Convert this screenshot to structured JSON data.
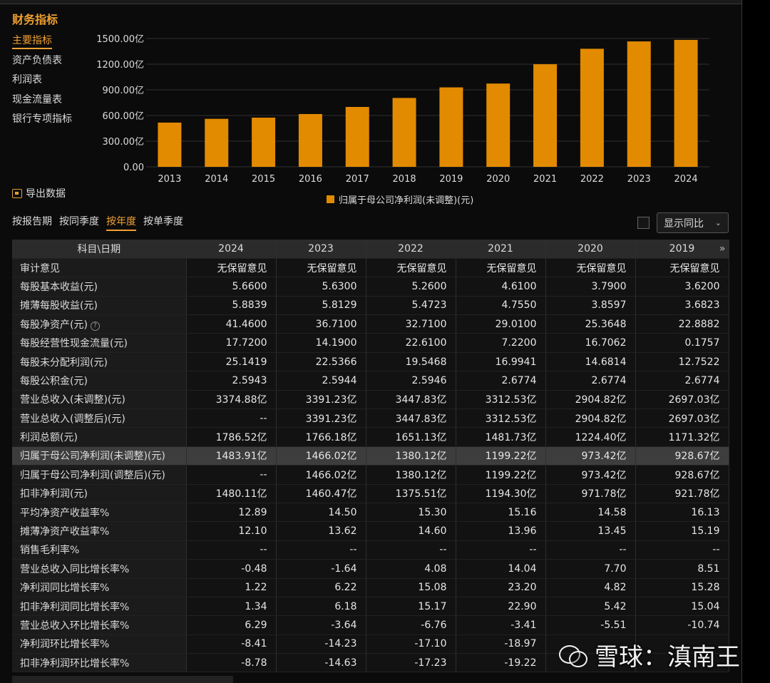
{
  "panel": {
    "title": "财务指标"
  },
  "sidebar": {
    "items": [
      {
        "label": "主要指标",
        "active": true
      },
      {
        "label": "资产负债表",
        "active": false
      },
      {
        "label": "利润表",
        "active": false
      },
      {
        "label": "现金流量表",
        "active": false
      },
      {
        "label": "银行专项指标",
        "active": false
      }
    ]
  },
  "chart_data": {
    "type": "bar",
    "categories": [
      "2013",
      "2014",
      "2015",
      "2016",
      "2017",
      "2018",
      "2019",
      "2020",
      "2021",
      "2022",
      "2023",
      "2024"
    ],
    "series": [
      {
        "name": "归属于母公司净利润(未调整)(元)",
        "values": [
          517,
          561,
          575,
          617,
          700,
          805,
          928.67,
          973.42,
          1199.22,
          1380.12,
          1466.02,
          1483.91
        ]
      }
    ],
    "ylim": [
      0,
      1500
    ],
    "yticks": [
      0,
      300,
      600,
      900,
      1200,
      1500
    ],
    "ytick_labels": [
      "0.00",
      "300.00亿",
      "600.00亿",
      "900.00亿",
      "1200.00亿",
      "1500.00亿"
    ],
    "grid": true,
    "legend": "bottom-center",
    "bar_color": "#e28a00"
  },
  "export_label": "导出数据",
  "legend_label": "归属于母公司净利润(未调整)(元)",
  "period_tabs": [
    {
      "label": "按报告期",
      "active": false
    },
    {
      "label": "按同季度",
      "active": false
    },
    {
      "label": "按年度",
      "active": true
    },
    {
      "label": "按单季度",
      "active": false
    }
  ],
  "yoy_toggle": {
    "label": "显示同比",
    "checked": false
  },
  "table": {
    "header": [
      "科目\\日期",
      "2024",
      "2023",
      "2022",
      "2021",
      "2020",
      "2019"
    ],
    "rows": [
      {
        "label": "审计意见",
        "values": [
          "无保留意见",
          "无保留意见",
          "无保留意见",
          "无保留意见",
          "无保留意见",
          "无保留意见"
        ]
      },
      {
        "label": "每股基本收益(元)",
        "values": [
          "5.6600",
          "5.6300",
          "5.2600",
          "4.6100",
          "3.7900",
          "3.6200"
        ]
      },
      {
        "label": "摊薄每股收益(元)",
        "values": [
          "5.8839",
          "5.8129",
          "5.4723",
          "4.7550",
          "3.8597",
          "3.6823"
        ]
      },
      {
        "label": "每股净资产(元)",
        "help": "?",
        "values": [
          "41.4600",
          "36.7100",
          "32.7100",
          "29.0100",
          "25.3648",
          "22.8882"
        ]
      },
      {
        "label": "每股经营性现金流量(元)",
        "values": [
          "17.7200",
          "14.1900",
          "22.6100",
          "7.2200",
          "16.7062",
          "0.1757"
        ]
      },
      {
        "label": "每股未分配利润(元)",
        "values": [
          "25.1419",
          "22.5366",
          "19.5468",
          "16.9941",
          "14.6814",
          "12.7522"
        ]
      },
      {
        "label": "每股公积金(元)",
        "values": [
          "2.5943",
          "2.5944",
          "2.5946",
          "2.6774",
          "2.6774",
          "2.6774"
        ]
      },
      {
        "label": "营业总收入(未调整)(元)",
        "values": [
          "3374.88亿",
          "3391.23亿",
          "3447.83亿",
          "3312.53亿",
          "2904.82亿",
          "2697.03亿"
        ]
      },
      {
        "label": "营业总收入(调整后)(元)",
        "values": [
          "--",
          "3391.23亿",
          "3447.83亿",
          "3312.53亿",
          "2904.82亿",
          "2697.03亿"
        ]
      },
      {
        "label": "利润总额(元)",
        "values": [
          "1786.52亿",
          "1766.18亿",
          "1651.13亿",
          "1481.73亿",
          "1224.40亿",
          "1171.32亿"
        ]
      },
      {
        "label": "归属于母公司净利润(未调整)(元)",
        "highlight": true,
        "values": [
          "1483.91亿",
          "1466.02亿",
          "1380.12亿",
          "1199.22亿",
          "973.42亿",
          "928.67亿"
        ]
      },
      {
        "label": "归属于母公司净利润(调整后)(元)",
        "values": [
          "--",
          "1466.02亿",
          "1380.12亿",
          "1199.22亿",
          "973.42亿",
          "928.67亿"
        ]
      },
      {
        "label": "扣非净利润(元)",
        "values": [
          "1480.11亿",
          "1460.47亿",
          "1375.51亿",
          "1194.30亿",
          "971.78亿",
          "921.78亿"
        ]
      },
      {
        "label": "平均净资产收益率%",
        "values": [
          "12.89",
          "14.50",
          "15.30",
          "15.16",
          "14.58",
          "16.13"
        ]
      },
      {
        "label": "摊薄净资产收益率%",
        "values": [
          "12.10",
          "13.62",
          "14.60",
          "13.96",
          "13.45",
          "15.19"
        ]
      },
      {
        "label": "销售毛利率%",
        "values": [
          "--",
          "--",
          "--",
          "--",
          "--",
          "--"
        ]
      },
      {
        "label": "营业总收入同比增长率%",
        "values": [
          "-0.48",
          "-1.64",
          "4.08",
          "14.04",
          "7.70",
          "8.51"
        ]
      },
      {
        "label": "净利润同比增长率%",
        "values": [
          "1.22",
          "6.22",
          "15.08",
          "23.20",
          "4.82",
          "15.28"
        ]
      },
      {
        "label": "扣非净利润同比增长率%",
        "values": [
          "1.34",
          "6.18",
          "15.17",
          "22.90",
          "5.42",
          "15.04"
        ]
      },
      {
        "label": "营业总收入环比增长率%",
        "values": [
          "6.29",
          "-3.64",
          "-6.76",
          "-3.41",
          "-5.51",
          "-10.74"
        ]
      },
      {
        "label": "净利润环比增长率%",
        "values": [
          "-8.41",
          "-14.23",
          "-17.10",
          "-18.97",
          "",
          ""
        ]
      },
      {
        "label": "扣非净利润环比增长率%",
        "values": [
          "-8.78",
          "-14.63",
          "-17.23",
          "-19.22",
          "",
          ""
        ]
      }
    ]
  },
  "watermark": {
    "text": "雪球：滇南王"
  }
}
